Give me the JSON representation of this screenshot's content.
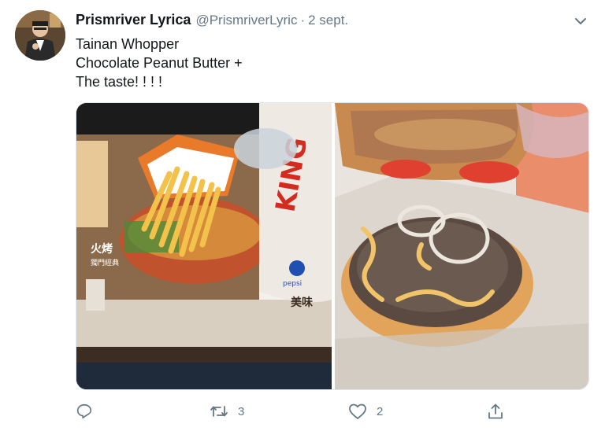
{
  "tweet": {
    "display_name": "Prismriver Lyrica",
    "handle": "@PrismriverLyric",
    "separator": "·",
    "date": "2 sept.",
    "text_lines": [
      "Tainan Whopper",
      "Chocolate Peanut Butter +",
      "The taste! ! ! !"
    ]
  },
  "media": {
    "left_photo": {
      "alt": "",
      "tray_text_1": "火烤",
      "tray_text_2": "獨門經典",
      "tray_text_3": "美味",
      "cup_text": "KING",
      "cup_small": "pepsi"
    },
    "right_photo": {
      "alt": ""
    }
  },
  "actions": {
    "reply": {
      "icon": "reply-icon",
      "count": ""
    },
    "retweet": {
      "icon": "retweet-icon",
      "count": "3"
    },
    "like": {
      "icon": "heart-icon",
      "count": "2"
    },
    "share": {
      "icon": "share-icon"
    }
  },
  "colors": {
    "text_primary": "#14171a",
    "text_secondary": "#657786",
    "border": "#e1e8ed"
  }
}
